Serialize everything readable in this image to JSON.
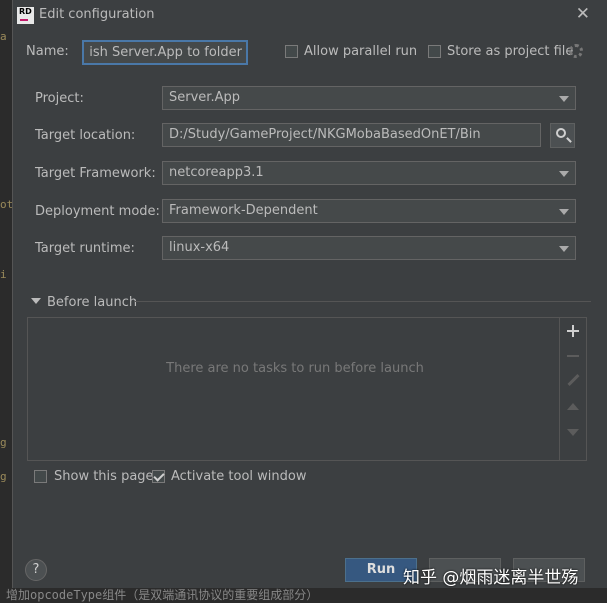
{
  "background": {
    "bottom_code": "增加opcodeType组件（是双端通讯协议的重要组成部分）"
  },
  "titlebar": {
    "badge": "RD",
    "title": "Edit configuration"
  },
  "header": {
    "name_label": "Name:",
    "name_value": "Publish Server.App to folder",
    "allow_parallel_label": "Allow parallel run",
    "store_project_label": "Store as project file"
  },
  "form": {
    "project_label": "Project:",
    "project_value": "Server.App",
    "target_location_label": "Target location:",
    "target_location_value": "D:/Study/GameProject/NKGMobaBasedOnET/Bin",
    "framework_label": "Target Framework:",
    "framework_value": "netcoreapp3.1",
    "deployment_label": "Deployment mode:",
    "deployment_value": "Framework-Dependent",
    "runtime_label": "Target runtime:",
    "runtime_value": "linux-x64"
  },
  "before_launch": {
    "title": "Before launch",
    "empty_text": "There are no tasks to run before launch"
  },
  "options": {
    "show_page_label": "Show this page",
    "activate_tool_label": "Activate tool window"
  },
  "footer": {
    "help": "?",
    "run_label": "Run"
  },
  "watermark": "知乎 @烟雨迷离半世殇"
}
